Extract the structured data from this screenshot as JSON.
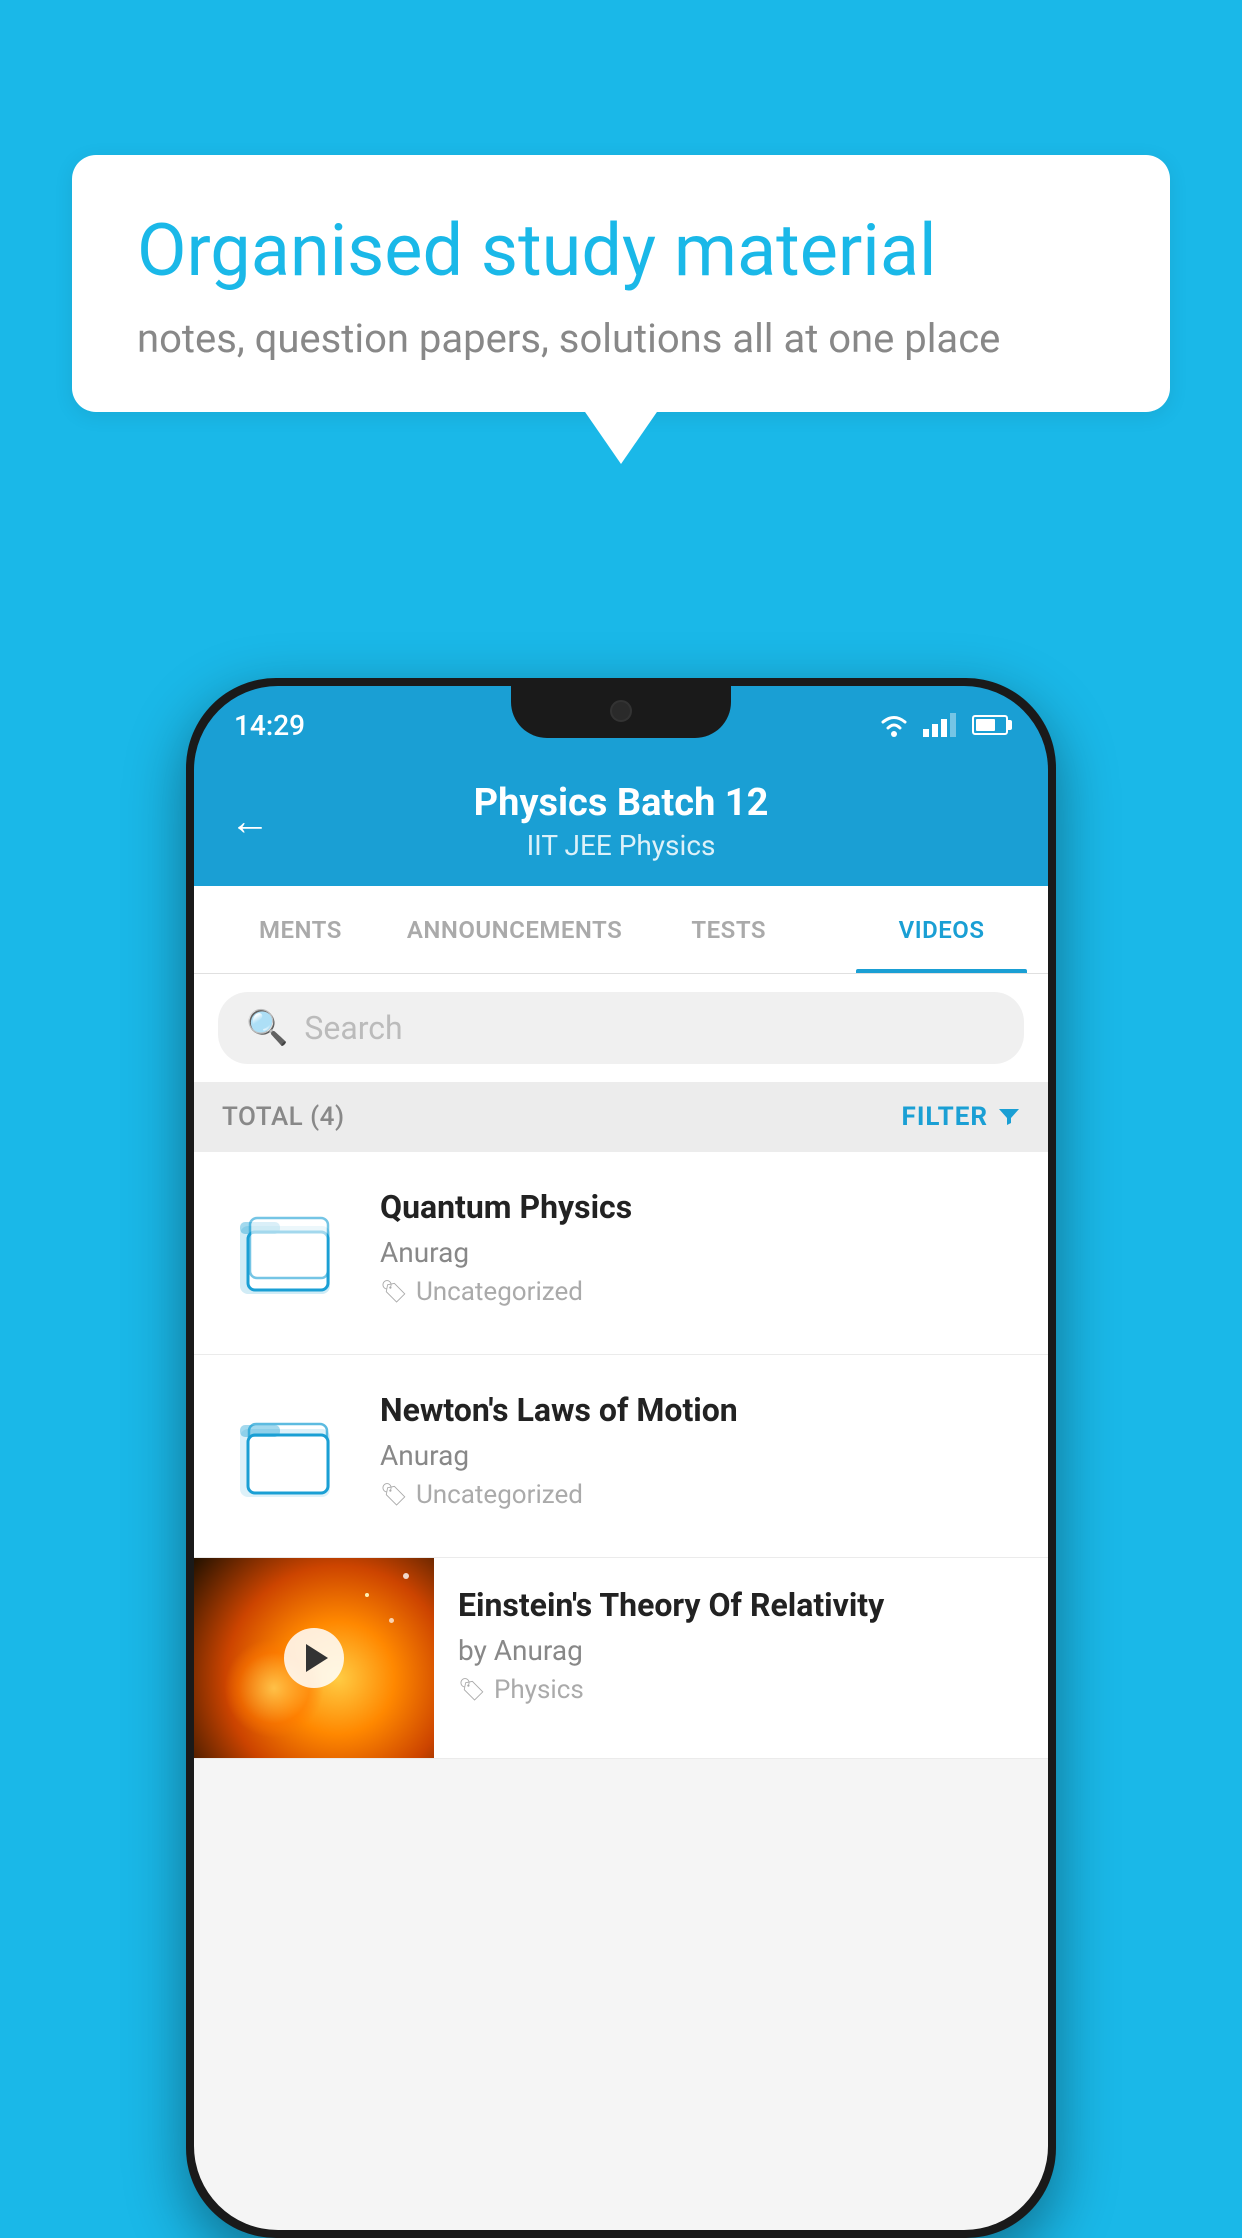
{
  "background_color": "#1ab8e8",
  "speech_bubble": {
    "title": "Organised study material",
    "subtitle": "notes, question papers, solutions all at one place"
  },
  "status_bar": {
    "time": "14:29"
  },
  "app_header": {
    "title": "Physics Batch 12",
    "subtitle": "IIT JEE   Physics",
    "back_label": "←"
  },
  "tabs": [
    {
      "label": "MENTS",
      "active": false
    },
    {
      "label": "ANNOUNCEMENTS",
      "active": false
    },
    {
      "label": "TESTS",
      "active": false
    },
    {
      "label": "VIDEOS",
      "active": true
    }
  ],
  "search": {
    "placeholder": "Search"
  },
  "filter_bar": {
    "total_label": "TOTAL (4)",
    "filter_label": "FILTER"
  },
  "videos": [
    {
      "id": "quantum",
      "title": "Quantum Physics",
      "author": "Anurag",
      "tag": "Uncategorized",
      "has_thumbnail": false
    },
    {
      "id": "newton",
      "title": "Newton's Laws of Motion",
      "author": "Anurag",
      "tag": "Uncategorized",
      "has_thumbnail": false
    },
    {
      "id": "einstein",
      "title": "Einstein's Theory Of Relativity",
      "author": "by Anurag",
      "tag": "Physics",
      "has_thumbnail": true
    }
  ]
}
